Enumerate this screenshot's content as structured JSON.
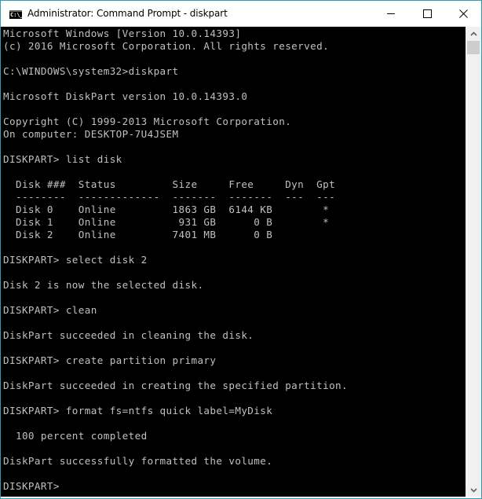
{
  "window": {
    "title": "Administrator: Command Prompt - diskpart",
    "icon": "cmd-icon",
    "icon_text": "C:\\_",
    "controls": {
      "minimize": "minimize-icon",
      "maximize": "maximize-icon",
      "close": "close-icon"
    },
    "border_color": "#2b9fb5"
  },
  "console": {
    "background": "#000000",
    "foreground": "#c0c0c0",
    "lines": [
      "Microsoft Windows [Version 10.0.14393]",
      "(c) 2016 Microsoft Corporation. All rights reserved.",
      "",
      "C:\\WINDOWS\\system32>diskpart",
      "",
      "Microsoft DiskPart version 10.0.14393.0",
      "",
      "Copyright (C) 1999-2013 Microsoft Corporation.",
      "On computer: DESKTOP-7U4JSEM",
      "",
      "DISKPART> list disk",
      "",
      "  Disk ###  Status         Size     Free     Dyn  Gpt",
      "  --------  -------------  -------  -------  ---  ---",
      "  Disk 0    Online         1863 GB  6144 KB        *",
      "  Disk 1    Online          931 GB      0 B        *",
      "  Disk 2    Online         7401 MB      0 B",
      "",
      "DISKPART> select disk 2",
      "",
      "Disk 2 is now the selected disk.",
      "",
      "DISKPART> clean",
      "",
      "DiskPart succeeded in cleaning the disk.",
      "",
      "DISKPART> create partition primary",
      "",
      "DiskPart succeeded in creating the specified partition.",
      "",
      "DISKPART> format fs=ntfs quick label=MyDisk",
      "",
      "  100 percent completed",
      "",
      "DiskPart successfully formatted the volume.",
      "",
      "DISKPART> "
    ]
  },
  "disk_table": {
    "columns": [
      "Disk ###",
      "Status",
      "Size",
      "Free",
      "Dyn",
      "Gpt"
    ],
    "rows": [
      [
        "Disk 0",
        "Online",
        "1863 GB",
        "6144 KB",
        "",
        "*"
      ],
      [
        "Disk 1",
        "Online",
        "931 GB",
        "0 B",
        "",
        "*"
      ],
      [
        "Disk 2",
        "Online",
        "7401 MB",
        "0 B",
        "",
        ""
      ]
    ]
  },
  "scrollbar": {
    "up_icon": "chevron-up-icon",
    "down_icon": "chevron-down-icon",
    "position": 0
  }
}
